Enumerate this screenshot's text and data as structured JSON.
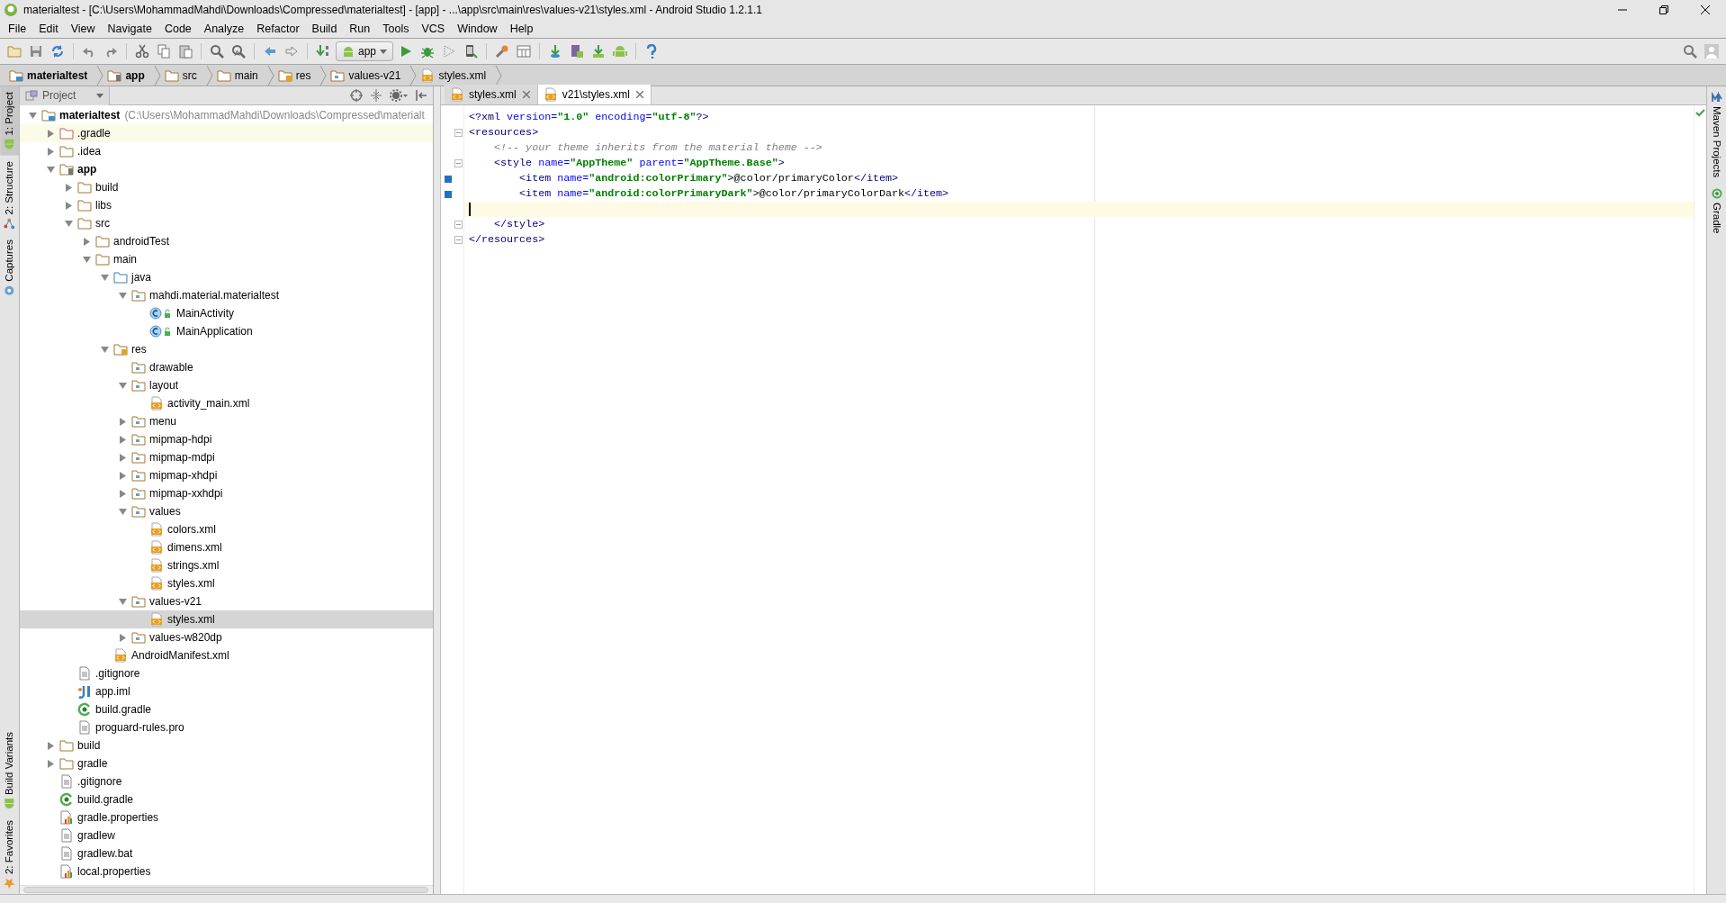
{
  "window": {
    "title": "materialtest - [C:\\Users\\MohammadMahdi\\Downloads\\Compressed\\materialtest] - [app] - ...\\app\\src\\main\\res\\values-v21\\styles.xml - Android Studio 1.2.1.1"
  },
  "main_menu": [
    "File",
    "Edit",
    "View",
    "Navigate",
    "Code",
    "Analyze",
    "Refactor",
    "Build",
    "Run",
    "Tools",
    "VCS",
    "Window",
    "Help"
  ],
  "toolbar": {
    "run_config": "app"
  },
  "breadcrumbs": [
    {
      "label": "materialtest",
      "kind": "project"
    },
    {
      "label": "app",
      "kind": "module"
    },
    {
      "label": "src",
      "kind": "folder"
    },
    {
      "label": "main",
      "kind": "folder"
    },
    {
      "label": "res",
      "kind": "res-folder"
    },
    {
      "label": "values-v21",
      "kind": "package"
    },
    {
      "label": "styles.xml",
      "kind": "xml"
    }
  ],
  "left_tool_tabs": [
    {
      "label": "1: Project",
      "selected": true,
      "kind": "android"
    },
    {
      "label": "2: Structure",
      "selected": false,
      "kind": "structure"
    },
    {
      "label": "Captures",
      "selected": false,
      "kind": "captures"
    }
  ],
  "left_tool_tabs_bottom": [
    {
      "label": "Build Variants",
      "selected": false,
      "kind": "android"
    },
    {
      "label": "2: Favorites",
      "selected": false,
      "kind": "star"
    }
  ],
  "right_tool_tabs": [
    {
      "label": "Maven Projects",
      "kind": "maven"
    },
    {
      "label": "Gradle",
      "kind": "gradle"
    }
  ],
  "project_panel": {
    "title": "Project",
    "tree": [
      {
        "label": "materialtest",
        "path": "(C:\\Users\\MohammadMahdi\\Downloads\\Compressed\\materialt",
        "kind": "project",
        "expanded": true,
        "selected": false,
        "children": [
          {
            "label": ".gradle",
            "kind": "excluded-folder",
            "expanded": false,
            "selected": false,
            "highlighted": true
          },
          {
            "label": ".idea",
            "kind": "folder",
            "expanded": false,
            "selected": false
          },
          {
            "label": "app",
            "kind": "module",
            "expanded": true,
            "selected": false,
            "children": [
              {
                "label": "build",
                "kind": "folder",
                "expanded": false,
                "selected": false
              },
              {
                "label": "libs",
                "kind": "folder",
                "expanded": false,
                "selected": false
              },
              {
                "label": "src",
                "kind": "folder",
                "expanded": true,
                "selected": false,
                "children": [
                  {
                    "label": "androidTest",
                    "kind": "folder",
                    "expanded": false,
                    "selected": false
                  },
                  {
                    "label": "main",
                    "kind": "folder",
                    "expanded": true,
                    "selected": false,
                    "children": [
                      {
                        "label": "java",
                        "kind": "source-folder",
                        "expanded": true,
                        "selected": false,
                        "children": [
                          {
                            "label": "mahdi.material.materialtest",
                            "kind": "package",
                            "expanded": true,
                            "selected": false,
                            "children": [
                              {
                                "label": "MainActivity",
                                "kind": "class",
                                "selected": false
                              },
                              {
                                "label": "MainApplication",
                                "kind": "class",
                                "selected": false
                              }
                            ]
                          }
                        ]
                      },
                      {
                        "label": "res",
                        "kind": "res-folder",
                        "expanded": true,
                        "selected": false,
                        "children": [
                          {
                            "label": "drawable",
                            "kind": "package",
                            "selected": false
                          },
                          {
                            "label": "layout",
                            "kind": "package",
                            "expanded": true,
                            "selected": false,
                            "children": [
                              {
                                "label": "activity_main.xml",
                                "kind": "xml",
                                "selected": false
                              }
                            ]
                          },
                          {
                            "label": "menu",
                            "kind": "package",
                            "expanded": false,
                            "selected": false
                          },
                          {
                            "label": "mipmap-hdpi",
                            "kind": "package",
                            "expanded": false,
                            "selected": false
                          },
                          {
                            "label": "mipmap-mdpi",
                            "kind": "package",
                            "expanded": false,
                            "selected": false
                          },
                          {
                            "label": "mipmap-xhdpi",
                            "kind": "package",
                            "expanded": false,
                            "selected": false
                          },
                          {
                            "label": "mipmap-xxhdpi",
                            "kind": "package",
                            "expanded": false,
                            "selected": false
                          },
                          {
                            "label": "values",
                            "kind": "package",
                            "expanded": true,
                            "selected": false,
                            "children": [
                              {
                                "label": "colors.xml",
                                "kind": "xml",
                                "selected": false
                              },
                              {
                                "label": "dimens.xml",
                                "kind": "xml",
                                "selected": false
                              },
                              {
                                "label": "strings.xml",
                                "kind": "xml",
                                "selected": false
                              },
                              {
                                "label": "styles.xml",
                                "kind": "xml",
                                "selected": false
                              }
                            ]
                          },
                          {
                            "label": "values-v21",
                            "kind": "package",
                            "expanded": true,
                            "selected": false,
                            "children": [
                              {
                                "label": "styles.xml",
                                "kind": "xml",
                                "selected": true
                              }
                            ]
                          },
                          {
                            "label": "values-w820dp",
                            "kind": "package",
                            "expanded": false,
                            "selected": false
                          }
                        ]
                      },
                      {
                        "label": "AndroidManifest.xml",
                        "kind": "xml",
                        "selected": false
                      }
                    ]
                  }
                ]
              },
              {
                "label": ".gitignore",
                "kind": "text",
                "selected": false
              },
              {
                "label": "app.iml",
                "kind": "iml",
                "selected": false
              },
              {
                "label": "build.gradle",
                "kind": "gradle",
                "selected": false
              },
              {
                "label": "proguard-rules.pro",
                "kind": "text",
                "selected": false
              }
            ]
          },
          {
            "label": "build",
            "kind": "folder",
            "expanded": false,
            "selected": false
          },
          {
            "label": "gradle",
            "kind": "folder",
            "expanded": false,
            "selected": false
          },
          {
            "label": ".gitignore",
            "kind": "text",
            "selected": false
          },
          {
            "label": "build.gradle",
            "kind": "gradle",
            "selected": false
          },
          {
            "label": "gradle.properties",
            "kind": "properties",
            "selected": false
          },
          {
            "label": "gradlew",
            "kind": "text",
            "selected": false
          },
          {
            "label": "gradlew.bat",
            "kind": "text",
            "selected": false
          },
          {
            "label": "local.properties",
            "kind": "properties",
            "selected": false
          }
        ]
      }
    ]
  },
  "editor_tabs": [
    {
      "label": "styles.xml",
      "selected": false
    },
    {
      "label": "v21\\styles.xml",
      "selected": true
    }
  ],
  "code_lines": [
    {
      "segments": [
        {
          "kind": "tag",
          "text": "<?xml"
        },
        {
          "kind": "attr",
          "text": " version="
        },
        {
          "kind": "string",
          "text": "\"1.0\""
        },
        {
          "kind": "attr",
          "text": " encoding="
        },
        {
          "kind": "string",
          "text": "\"utf-8\""
        },
        {
          "kind": "tag",
          "text": "?>"
        }
      ]
    },
    {
      "fold": true,
      "segments": [
        {
          "kind": "tag",
          "text": "<resources>"
        }
      ]
    },
    {
      "segments": [
        {
          "kind": "comment",
          "text": "    <!-- your theme inherits from the material theme -->"
        }
      ]
    },
    {
      "fold": true,
      "segments": [
        {
          "kind": "tag",
          "text": "    <style"
        },
        {
          "kind": "attr",
          "text": " name="
        },
        {
          "kind": "string",
          "text": "\"AppTheme\""
        },
        {
          "kind": "attr",
          "text": " parent="
        },
        {
          "kind": "string",
          "text": "\"AppTheme.Base\""
        },
        {
          "kind": "tag",
          "text": ">"
        }
      ]
    },
    {
      "changed": true,
      "segments": [
        {
          "kind": "tag",
          "text": "        <item"
        },
        {
          "kind": "attr",
          "text": " name="
        },
        {
          "kind": "string",
          "text": "\"android:colorPrimary\""
        },
        {
          "kind": "text",
          "text": ">@color/primaryColor"
        },
        {
          "kind": "tag",
          "text": "</item>"
        }
      ]
    },
    {
      "changed": true,
      "segments": [
        {
          "kind": "tag",
          "text": "        <item"
        },
        {
          "kind": "attr",
          "text": " name="
        },
        {
          "kind": "string",
          "text": "\"android:colorPrimaryDark\""
        },
        {
          "kind": "text",
          "text": ">@color/primaryColorDark"
        },
        {
          "kind": "tag",
          "text": "</item>"
        }
      ]
    },
    {
      "current": true
    },
    {
      "fold": true,
      "segments": [
        {
          "kind": "tag",
          "text": "    </style>"
        }
      ]
    },
    {
      "fold": true,
      "segments": [
        {
          "kind": "tag",
          "text": "</resources>"
        }
      ]
    }
  ]
}
